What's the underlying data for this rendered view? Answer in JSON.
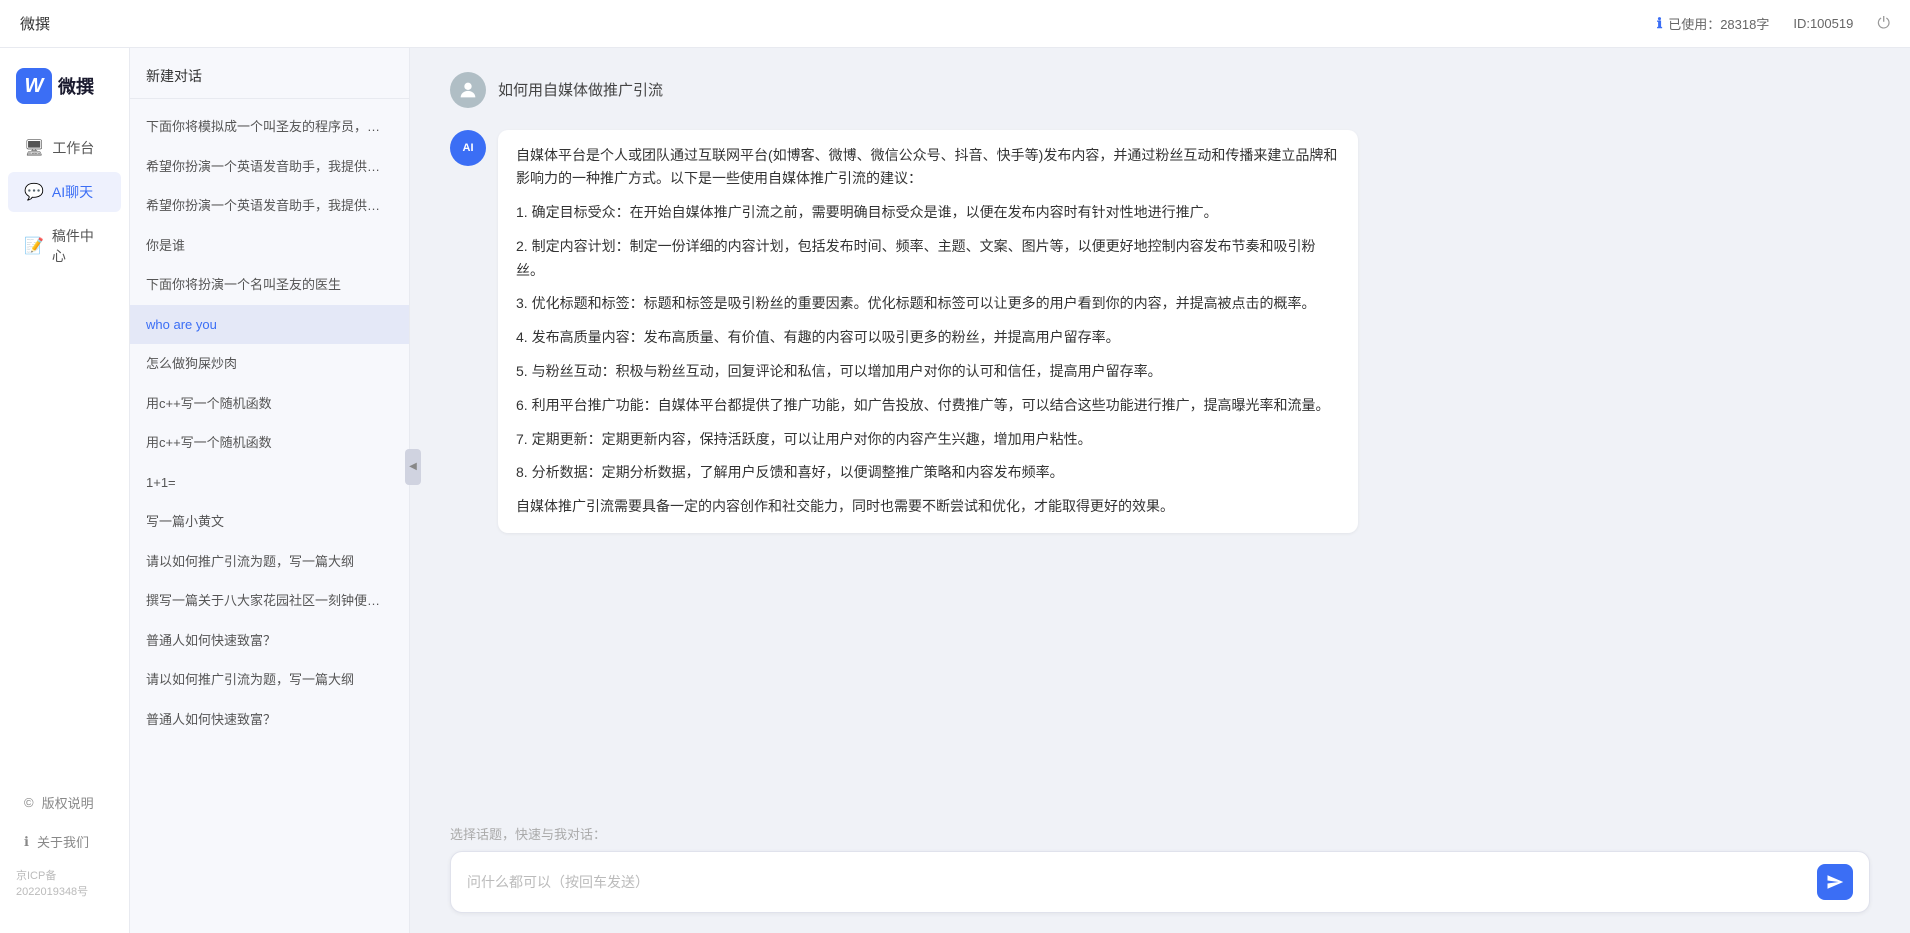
{
  "topbar": {
    "title": "微撰",
    "usage_label": "已使用：28318字",
    "usage_icon": "info-icon",
    "id_label": "ID:100519",
    "power_icon": "power-icon"
  },
  "logo": {
    "w": "W",
    "text": "微撰"
  },
  "nav": {
    "items": [
      {
        "id": "workbench",
        "icon": "🖥",
        "label": "工作台"
      },
      {
        "id": "ai-chat",
        "icon": "💬",
        "label": "AI聊天"
      },
      {
        "id": "draft",
        "icon": "📝",
        "label": "稿件中心"
      }
    ],
    "bottom_items": [
      {
        "id": "copyright",
        "icon": "©",
        "label": "版权说明"
      },
      {
        "id": "about",
        "icon": "ℹ",
        "label": "关于我们"
      }
    ],
    "icp": "京ICP备2022019348号"
  },
  "sidebar": {
    "header": "新建对话",
    "items": [
      {
        "id": 1,
        "text": "下面你将模拟成一个叫圣友的程序员，我说..."
      },
      {
        "id": 2,
        "text": "希望你扮演一个英语发音助手，我提供给你..."
      },
      {
        "id": 3,
        "text": "希望你扮演一个英语发音助手，我提供给你..."
      },
      {
        "id": 4,
        "text": "你是谁"
      },
      {
        "id": 5,
        "text": "下面你将扮演一个名叫圣友的医生"
      },
      {
        "id": 6,
        "text": "who are you"
      },
      {
        "id": 7,
        "text": "怎么做狗屎炒肉"
      },
      {
        "id": 8,
        "text": "用c++写一个随机函数"
      },
      {
        "id": 9,
        "text": "用c++写一个随机函数"
      },
      {
        "id": 10,
        "text": "1+1="
      },
      {
        "id": 11,
        "text": "写一篇小黄文"
      },
      {
        "id": 12,
        "text": "请以如何推广引流为题，写一篇大纲"
      },
      {
        "id": 13,
        "text": "撰写一篇关于八大家花园社区一刻钟便民生..."
      },
      {
        "id": 14,
        "text": "普通人如何快速致富？"
      },
      {
        "id": 15,
        "text": "请以如何推广引流为题，写一篇大纲"
      },
      {
        "id": 16,
        "text": "普通人如何快速致富？"
      }
    ]
  },
  "chat": {
    "user_message": "如何用自媒体做推广引流",
    "ai_response": {
      "paragraphs": [
        "自媒体平台是个人或团队通过互联网平台(如博客、微博、微信公众号、抖音、快手等)发布内容，并通过粉丝互动和传播来建立品牌和影响力的一种推广方式。以下是一些使用自媒体推广引流的建议：",
        "1. 确定目标受众：在开始自媒体推广引流之前，需要明确目标受众是谁，以便在发布内容时有针对性地进行推广。",
        "2. 制定内容计划：制定一份详细的内容计划，包括发布时间、频率、主题、文案、图片等，以便更好地控制内容发布节奏和吸引粉丝。",
        "3. 优化标题和标签：标题和标签是吸引粉丝的重要因素。优化标题和标签可以让更多的用户看到你的内容，并提高被点击的概率。",
        "4. 发布高质量内容：发布高质量、有价值、有趣的内容可以吸引更多的粉丝，并提高用户留存率。",
        "5. 与粉丝互动：积极与粉丝互动，回复评论和私信，可以增加用户对你的认可和信任，提高用户留存率。",
        "6. 利用平台推广功能：自媒体平台都提供了推广功能，如广告投放、付费推广等，可以结合这些功能进行推广，提高曝光率和流量。",
        "7. 定期更新：定期更新内容，保持活跃度，可以让用户对你的内容产生兴趣，增加用户粘性。",
        "8. 分析数据：定期分析数据，了解用户反馈和喜好，以便调整推广策略和内容发布频率。",
        "自媒体推广引流需要具备一定的内容创作和社交能力，同时也需要不断尝试和优化，才能取得更好的效果。"
      ]
    }
  },
  "input": {
    "quick_label": "选择话题，快速与我对话：",
    "placeholder": "问什么都可以（按回车发送）",
    "send_icon": "send-icon"
  }
}
